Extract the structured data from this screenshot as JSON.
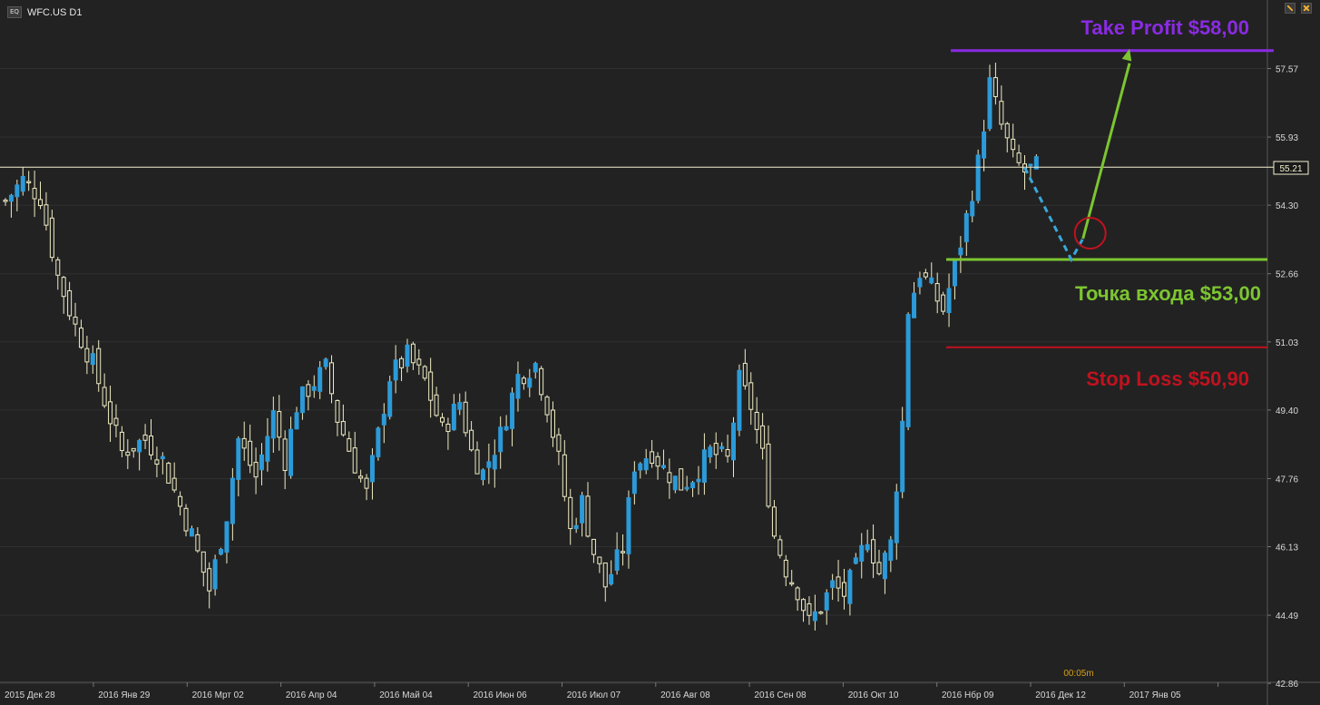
{
  "header": {
    "badge": "EQ",
    "symbol": "WFC.US D1"
  },
  "timer": "00:05m",
  "current_price_label": "55.21",
  "annotations": {
    "take_profit": "Take Profit $58,00",
    "entry": "Точка входа $53,00",
    "stop_loss": "Stop Loss $50,90"
  },
  "colors": {
    "background": "#222222",
    "up_candle": "#2c9ad8",
    "down_candle": "#f0ecc4",
    "take_profit": "#8a2be2",
    "entry": "#7cc531",
    "stop_loss": "#c1121f",
    "price_line": "#f4f0d0",
    "timer": "#d4a017"
  },
  "chart_data": {
    "type": "candlestick",
    "timeframe": "D1",
    "yticks": [
      "57.57",
      "55.93",
      "54.30",
      "52.66",
      "51.03",
      "49.40",
      "47.76",
      "46.13",
      "44.49",
      "42.86"
    ],
    "ylim": [
      42.86,
      58.6
    ],
    "xticks": [
      "2015 Дек 28",
      "2016 Янв 29",
      "2016 Мрт 02",
      "2016 Апр 04",
      "2016 Май 04",
      "2016 Июн 06",
      "2016 Июл 07",
      "2016 Авг 08",
      "2016 Сен 08",
      "2016 Окт 10",
      "2016 Нбр 09",
      "2016 Дек 12",
      "2017 Янв 05"
    ],
    "levels": {
      "take_profit": 58.0,
      "entry": 53.0,
      "stop_loss": 50.9,
      "current": 55.21
    },
    "close_path": [
      [
        0,
        54.4
      ],
      [
        3,
        54.9
      ],
      [
        6,
        54.5
      ],
      [
        9,
        52.6
      ],
      [
        12,
        51.4
      ],
      [
        15,
        50.5
      ],
      [
        18,
        49.2
      ],
      [
        20,
        48.4
      ],
      [
        24,
        48.7
      ],
      [
        27,
        48.2
      ],
      [
        30,
        47.1
      ],
      [
        32,
        46.4
      ],
      [
        35,
        45.1
      ],
      [
        38,
        46.9
      ],
      [
        40,
        48.7
      ],
      [
        43,
        47.8
      ],
      [
        46,
        49.3
      ],
      [
        48,
        48.2
      ],
      [
        50,
        49.5
      ],
      [
        52,
        49.9
      ],
      [
        55,
        50.4
      ],
      [
        57,
        49.2
      ],
      [
        60,
        48.1
      ],
      [
        62,
        47.4
      ],
      [
        64,
        48.8
      ],
      [
        66,
        50.2
      ],
      [
        69,
        50.7
      ],
      [
        72,
        50.1
      ],
      [
        75,
        48.9
      ],
      [
        78,
        49.6
      ],
      [
        80,
        48.4
      ],
      [
        82,
        47.9
      ],
      [
        85,
        48.8
      ],
      [
        88,
        50.2
      ],
      [
        91,
        50.5
      ],
      [
        93,
        49.5
      ],
      [
        95,
        48.2
      ],
      [
        97,
        46.5
      ],
      [
        99,
        47.2
      ],
      [
        101,
        46.0
      ],
      [
        103,
        45.2
      ],
      [
        106,
        46.1
      ],
      [
        108,
        48.1
      ],
      [
        111,
        48.4
      ],
      [
        113,
        48.0
      ],
      [
        116,
        47.6
      ],
      [
        118,
        47.8
      ],
      [
        121,
        48.4
      ],
      [
        124,
        48.2
      ],
      [
        126,
        50.1
      ],
      [
        128,
        49.5
      ],
      [
        130,
        48.3
      ],
      [
        132,
        46.4
      ],
      [
        134,
        45.6
      ],
      [
        136,
        45.1
      ],
      [
        138,
        44.3
      ],
      [
        140,
        44.7
      ],
      [
        142,
        45.2
      ],
      [
        144,
        45.0
      ],
      [
        146,
        45.6
      ],
      [
        148,
        46.4
      ],
      [
        150,
        45.5
      ],
      [
        152,
        46.2
      ],
      [
        154,
        49.1
      ],
      [
        155,
        51.8
      ],
      [
        157,
        52.7
      ],
      [
        159,
        52.3
      ],
      [
        161,
        51.8
      ],
      [
        163,
        52.8
      ],
      [
        165,
        54.0
      ],
      [
        167,
        55.3
      ],
      [
        169,
        57.2
      ],
      [
        171,
        56.2
      ],
      [
        173,
        55.4
      ],
      [
        175,
        55.1
      ],
      [
        177,
        55.2
      ]
    ],
    "projection": [
      [
        175,
        55.2
      ],
      [
        183,
        53.0
      ],
      [
        185,
        53.5
      ],
      [
        193,
        58.0
      ]
    ]
  }
}
